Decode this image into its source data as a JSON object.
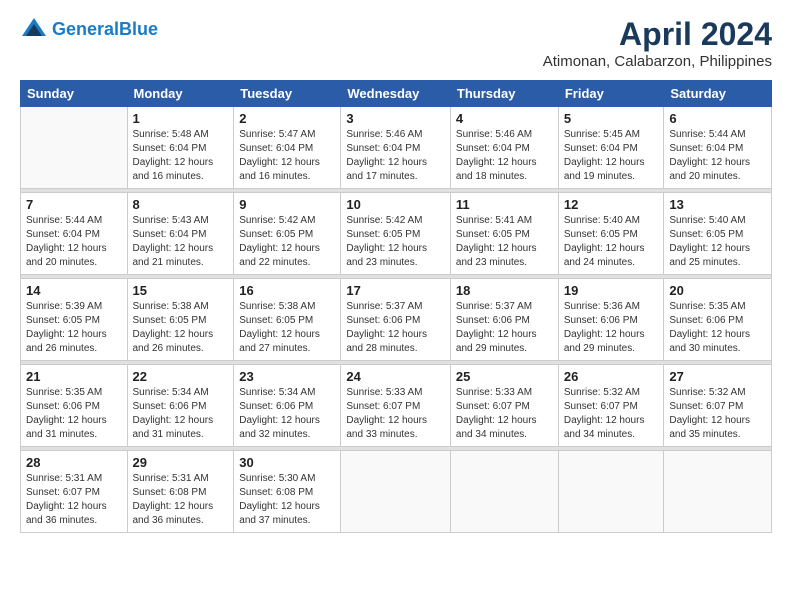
{
  "header": {
    "logo_line1": "General",
    "logo_line2": "Blue",
    "title": "April 2024",
    "subtitle": "Atimonan, Calabarzon, Philippines"
  },
  "weekdays": [
    "Sunday",
    "Monday",
    "Tuesday",
    "Wednesday",
    "Thursday",
    "Friday",
    "Saturday"
  ],
  "weeks": [
    [
      {
        "day": "",
        "info": ""
      },
      {
        "day": "1",
        "info": "Sunrise: 5:48 AM\nSunset: 6:04 PM\nDaylight: 12 hours\nand 16 minutes."
      },
      {
        "day": "2",
        "info": "Sunrise: 5:47 AM\nSunset: 6:04 PM\nDaylight: 12 hours\nand 16 minutes."
      },
      {
        "day": "3",
        "info": "Sunrise: 5:46 AM\nSunset: 6:04 PM\nDaylight: 12 hours\nand 17 minutes."
      },
      {
        "day": "4",
        "info": "Sunrise: 5:46 AM\nSunset: 6:04 PM\nDaylight: 12 hours\nand 18 minutes."
      },
      {
        "day": "5",
        "info": "Sunrise: 5:45 AM\nSunset: 6:04 PM\nDaylight: 12 hours\nand 19 minutes."
      },
      {
        "day": "6",
        "info": "Sunrise: 5:44 AM\nSunset: 6:04 PM\nDaylight: 12 hours\nand 20 minutes."
      }
    ],
    [
      {
        "day": "7",
        "info": "Sunrise: 5:44 AM\nSunset: 6:04 PM\nDaylight: 12 hours\nand 20 minutes."
      },
      {
        "day": "8",
        "info": "Sunrise: 5:43 AM\nSunset: 6:04 PM\nDaylight: 12 hours\nand 21 minutes."
      },
      {
        "day": "9",
        "info": "Sunrise: 5:42 AM\nSunset: 6:05 PM\nDaylight: 12 hours\nand 22 minutes."
      },
      {
        "day": "10",
        "info": "Sunrise: 5:42 AM\nSunset: 6:05 PM\nDaylight: 12 hours\nand 23 minutes."
      },
      {
        "day": "11",
        "info": "Sunrise: 5:41 AM\nSunset: 6:05 PM\nDaylight: 12 hours\nand 23 minutes."
      },
      {
        "day": "12",
        "info": "Sunrise: 5:40 AM\nSunset: 6:05 PM\nDaylight: 12 hours\nand 24 minutes."
      },
      {
        "day": "13",
        "info": "Sunrise: 5:40 AM\nSunset: 6:05 PM\nDaylight: 12 hours\nand 25 minutes."
      }
    ],
    [
      {
        "day": "14",
        "info": "Sunrise: 5:39 AM\nSunset: 6:05 PM\nDaylight: 12 hours\nand 26 minutes."
      },
      {
        "day": "15",
        "info": "Sunrise: 5:38 AM\nSunset: 6:05 PM\nDaylight: 12 hours\nand 26 minutes."
      },
      {
        "day": "16",
        "info": "Sunrise: 5:38 AM\nSunset: 6:05 PM\nDaylight: 12 hours\nand 27 minutes."
      },
      {
        "day": "17",
        "info": "Sunrise: 5:37 AM\nSunset: 6:06 PM\nDaylight: 12 hours\nand 28 minutes."
      },
      {
        "day": "18",
        "info": "Sunrise: 5:37 AM\nSunset: 6:06 PM\nDaylight: 12 hours\nand 29 minutes."
      },
      {
        "day": "19",
        "info": "Sunrise: 5:36 AM\nSunset: 6:06 PM\nDaylight: 12 hours\nand 29 minutes."
      },
      {
        "day": "20",
        "info": "Sunrise: 5:35 AM\nSunset: 6:06 PM\nDaylight: 12 hours\nand 30 minutes."
      }
    ],
    [
      {
        "day": "21",
        "info": "Sunrise: 5:35 AM\nSunset: 6:06 PM\nDaylight: 12 hours\nand 31 minutes."
      },
      {
        "day": "22",
        "info": "Sunrise: 5:34 AM\nSunset: 6:06 PM\nDaylight: 12 hours\nand 31 minutes."
      },
      {
        "day": "23",
        "info": "Sunrise: 5:34 AM\nSunset: 6:06 PM\nDaylight: 12 hours\nand 32 minutes."
      },
      {
        "day": "24",
        "info": "Sunrise: 5:33 AM\nSunset: 6:07 PM\nDaylight: 12 hours\nand 33 minutes."
      },
      {
        "day": "25",
        "info": "Sunrise: 5:33 AM\nSunset: 6:07 PM\nDaylight: 12 hours\nand 34 minutes."
      },
      {
        "day": "26",
        "info": "Sunrise: 5:32 AM\nSunset: 6:07 PM\nDaylight: 12 hours\nand 34 minutes."
      },
      {
        "day": "27",
        "info": "Sunrise: 5:32 AM\nSunset: 6:07 PM\nDaylight: 12 hours\nand 35 minutes."
      }
    ],
    [
      {
        "day": "28",
        "info": "Sunrise: 5:31 AM\nSunset: 6:07 PM\nDaylight: 12 hours\nand 36 minutes."
      },
      {
        "day": "29",
        "info": "Sunrise: 5:31 AM\nSunset: 6:08 PM\nDaylight: 12 hours\nand 36 minutes."
      },
      {
        "day": "30",
        "info": "Sunrise: 5:30 AM\nSunset: 6:08 PM\nDaylight: 12 hours\nand 37 minutes."
      },
      {
        "day": "",
        "info": ""
      },
      {
        "day": "",
        "info": ""
      },
      {
        "day": "",
        "info": ""
      },
      {
        "day": "",
        "info": ""
      }
    ]
  ]
}
